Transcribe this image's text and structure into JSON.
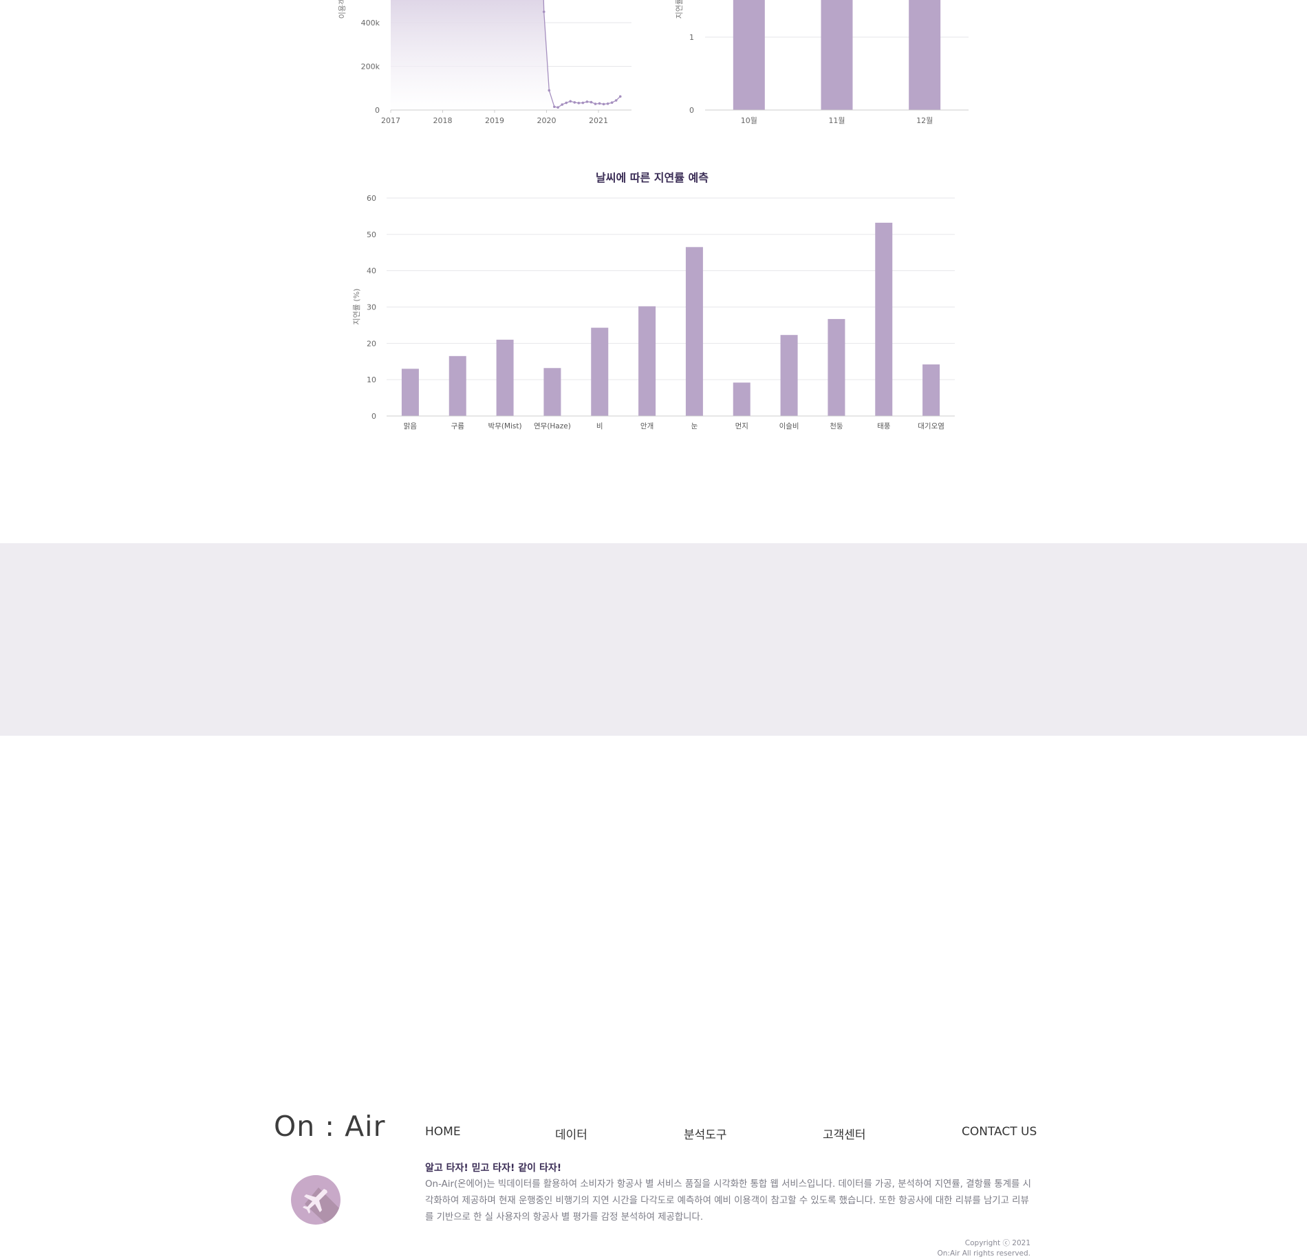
{
  "top_left_chart": {
    "ylabel": "이용객",
    "yticks": [
      "0",
      "200k",
      "400k"
    ],
    "xticks": [
      "2017",
      "2018",
      "2019",
      "2020",
      "2021"
    ],
    "chart_data": {
      "type": "area",
      "ylabel": "이용객",
      "x_ticks": [
        "2017",
        "2018",
        "2019",
        "2020",
        "2021"
      ],
      "points": [
        {
          "x": 2019.95,
          "y": 450000
        },
        {
          "x": 2020.05,
          "y": 90000
        },
        {
          "x": 2020.15,
          "y": 15000
        },
        {
          "x": 2020.22,
          "y": 12000
        },
        {
          "x": 2020.3,
          "y": 25000
        },
        {
          "x": 2020.38,
          "y": 33000
        },
        {
          "x": 2020.46,
          "y": 40000
        },
        {
          "x": 2020.54,
          "y": 35000
        },
        {
          "x": 2020.62,
          "y": 32000
        },
        {
          "x": 2020.7,
          "y": 33000
        },
        {
          "x": 2020.78,
          "y": 38000
        },
        {
          "x": 2020.86,
          "y": 36000
        },
        {
          "x": 2020.94,
          "y": 28000
        },
        {
          "x": 2021.02,
          "y": 30000
        },
        {
          "x": 2021.1,
          "y": 27000
        },
        {
          "x": 2021.18,
          "y": 29000
        },
        {
          "x": 2021.26,
          "y": 34000
        },
        {
          "x": 2021.34,
          "y": 44000
        },
        {
          "x": 2021.42,
          "y": 62000
        }
      ],
      "ylim": [
        0,
        500000
      ]
    }
  },
  "top_right_chart": {
    "ylabel": "지연률",
    "yticks": [
      "0",
      "1"
    ],
    "chart_data": {
      "type": "bar",
      "ylabel": "지연률",
      "categories": [
        "10월",
        "11월",
        "12월"
      ],
      "ylim": [
        0,
        1.5
      ]
    }
  },
  "main_chart": {
    "title": "날씨에 따른 지연률 예측",
    "ylabel": "지연률 (%)",
    "yticks": [
      "0",
      "10",
      "20",
      "30",
      "40",
      "50",
      "60"
    ],
    "chart_data": {
      "type": "bar",
      "title": "날씨에 따른 지연률 예측",
      "ylabel": "지연률 (%)",
      "ylim": [
        0,
        60
      ],
      "categories": [
        "맑음",
        "구름",
        "박무(Mist)",
        "연무(Haze)",
        "비",
        "안개",
        "눈",
        "먼지",
        "이슬비",
        "천둥",
        "태풍",
        "대기오염"
      ],
      "values": [
        13,
        16.5,
        21,
        13.2,
        24.3,
        30.2,
        46.5,
        9.2,
        22.3,
        26.7,
        53.2,
        14.2
      ],
      "grid": true,
      "color": "#b8a5c8"
    }
  },
  "footer": {
    "logo": "On : Air",
    "nav": [
      "HOME",
      "데이터",
      "분석도구",
      "고객센터",
      "CONTACT US"
    ],
    "slogan": "알고 타자! 믿고 타자! 같이 타자!",
    "description": "On-Air(온에어)는 빅데이터를 활용하여 소비자가 항공사 별 서비스 품질을 시각화한 통합 웹 서비스입니다. 데이터를 가공, 분석하여 지연률, 결항률 통계를 시각화하여 제공하며 현재 운행중인 비행기의 지연 시간을 다각도로 예측하여 예비 이용객이 참고할 수 있도록 했습니다. 또한 항공사에 대한 리뷰를 남기고 리뷰를 기반으로 한 실 사용자의 항공사 별 평가를 감정 분석하여 제공합니다.",
    "copyright": "Copyright ⓒ 2021",
    "rights": "On:Air All rights reserved.",
    "plane_icon": "airplane-icon",
    "colors": {
      "background": "#eeecf1",
      "accent": "#c8a9c8",
      "bar": "#b8a5c8"
    }
  }
}
